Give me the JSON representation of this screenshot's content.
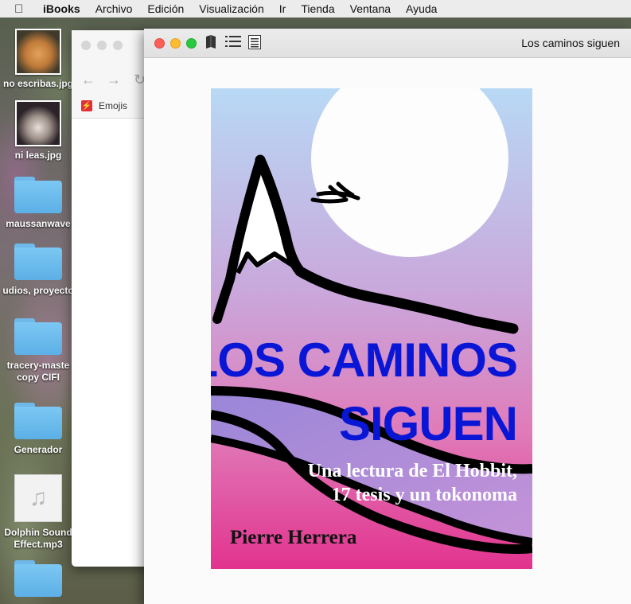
{
  "menubar": {
    "apple_icon": "apple-icon",
    "items": [
      "iBooks",
      "Archivo",
      "Edición",
      "Visualización",
      "Ir",
      "Tienda",
      "Ventana",
      "Ayuda"
    ]
  },
  "desktop": {
    "icons": [
      {
        "label": "no escribas.jpg"
      },
      {
        "label": "ni leas.jpg"
      },
      {
        "label": "maussanwave"
      },
      {
        "label": "udios, proyecto"
      },
      {
        "label": "tracery-maste",
        "label2": "copy CIFI"
      },
      {
        "label": "Generador"
      },
      {
        "label": "Dolphin Sound",
        "label2": "Effect.mp3"
      }
    ]
  },
  "browser": {
    "bookmark": "Emojis",
    "back_icon": "back-arrow-icon",
    "forward_icon": "forward-arrow-icon"
  },
  "reader": {
    "window_title": "Los caminos siguen",
    "book": {
      "title_line1": "LOS CAMINOS",
      "title_line2": "SIGUEN",
      "subtitle_line1": "Una lectura de El Hobbit,",
      "subtitle_line2": "17 tesis y un tokonoma",
      "author": "Pierre Herrera"
    },
    "colors": {
      "title": "#0a16d6",
      "sky_top": "#b8d9f5",
      "sky_bottom": "#e2338e"
    }
  }
}
